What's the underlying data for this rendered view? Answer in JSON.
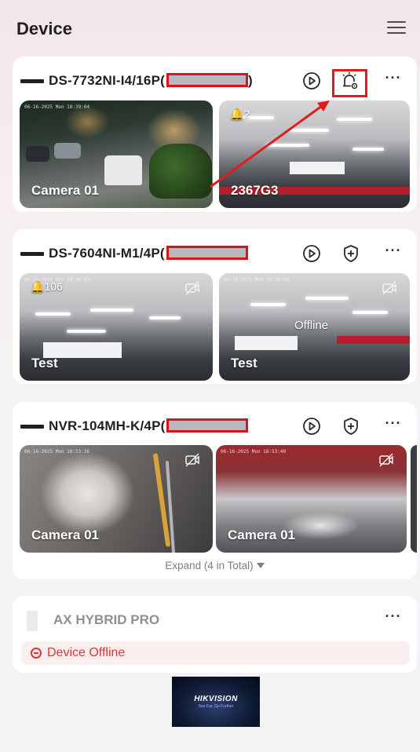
{
  "header": {
    "title": "Device",
    "menu_icon": "hamburger-menu-icon"
  },
  "devices": [
    {
      "name": "DS-7732NI-I4/16P(",
      "close_paren": ")",
      "actions": [
        "playback-icon",
        "alarm-settings-icon",
        "more-icon"
      ],
      "cameras": [
        {
          "label": "Camera 01",
          "badge": "",
          "status": "",
          "osd": "06-16-2025 Mon 18:39:04"
        },
        {
          "label": "2367G3",
          "badge": "2",
          "status": "",
          "osd": ""
        }
      ]
    },
    {
      "name": "DS-7604NI-M1/4P(",
      "close_paren": "",
      "actions": [
        "playback-icon",
        "shield-plus-icon",
        "more-icon"
      ],
      "cameras": [
        {
          "label": "Test",
          "badge": "106",
          "status": "",
          "osd": "06-16-2025 Mon 18:34:43"
        },
        {
          "label": "Test",
          "badge": "",
          "status": "Offline",
          "osd": "06-16-2025 Mon 18:34:09"
        }
      ]
    },
    {
      "name": "NVR-104MH-K/4P(",
      "close_paren": "",
      "actions": [
        "playback-icon",
        "shield-plus-icon",
        "more-icon"
      ],
      "cameras": [
        {
          "label": "Camera 01",
          "badge": "",
          "status": "",
          "osd": "06-16-2025 Mon 18:53:36"
        },
        {
          "label": "Camera 01",
          "badge": "",
          "status": "",
          "osd": "06-16-2025 Mon 18:53:40"
        }
      ],
      "expand_label": "Expand (4 in Total)"
    },
    {
      "name": "AX HYBRID PRO",
      "status_text": "Device Offline"
    }
  ],
  "more_glyph": "···",
  "logo": {
    "text": "HIKVISION",
    "tagline": "See Far, Go Further"
  },
  "colors": {
    "accent_red": "#e0333a",
    "annotation_red": "#e01c1c",
    "card_bg": "#ffffff"
  }
}
